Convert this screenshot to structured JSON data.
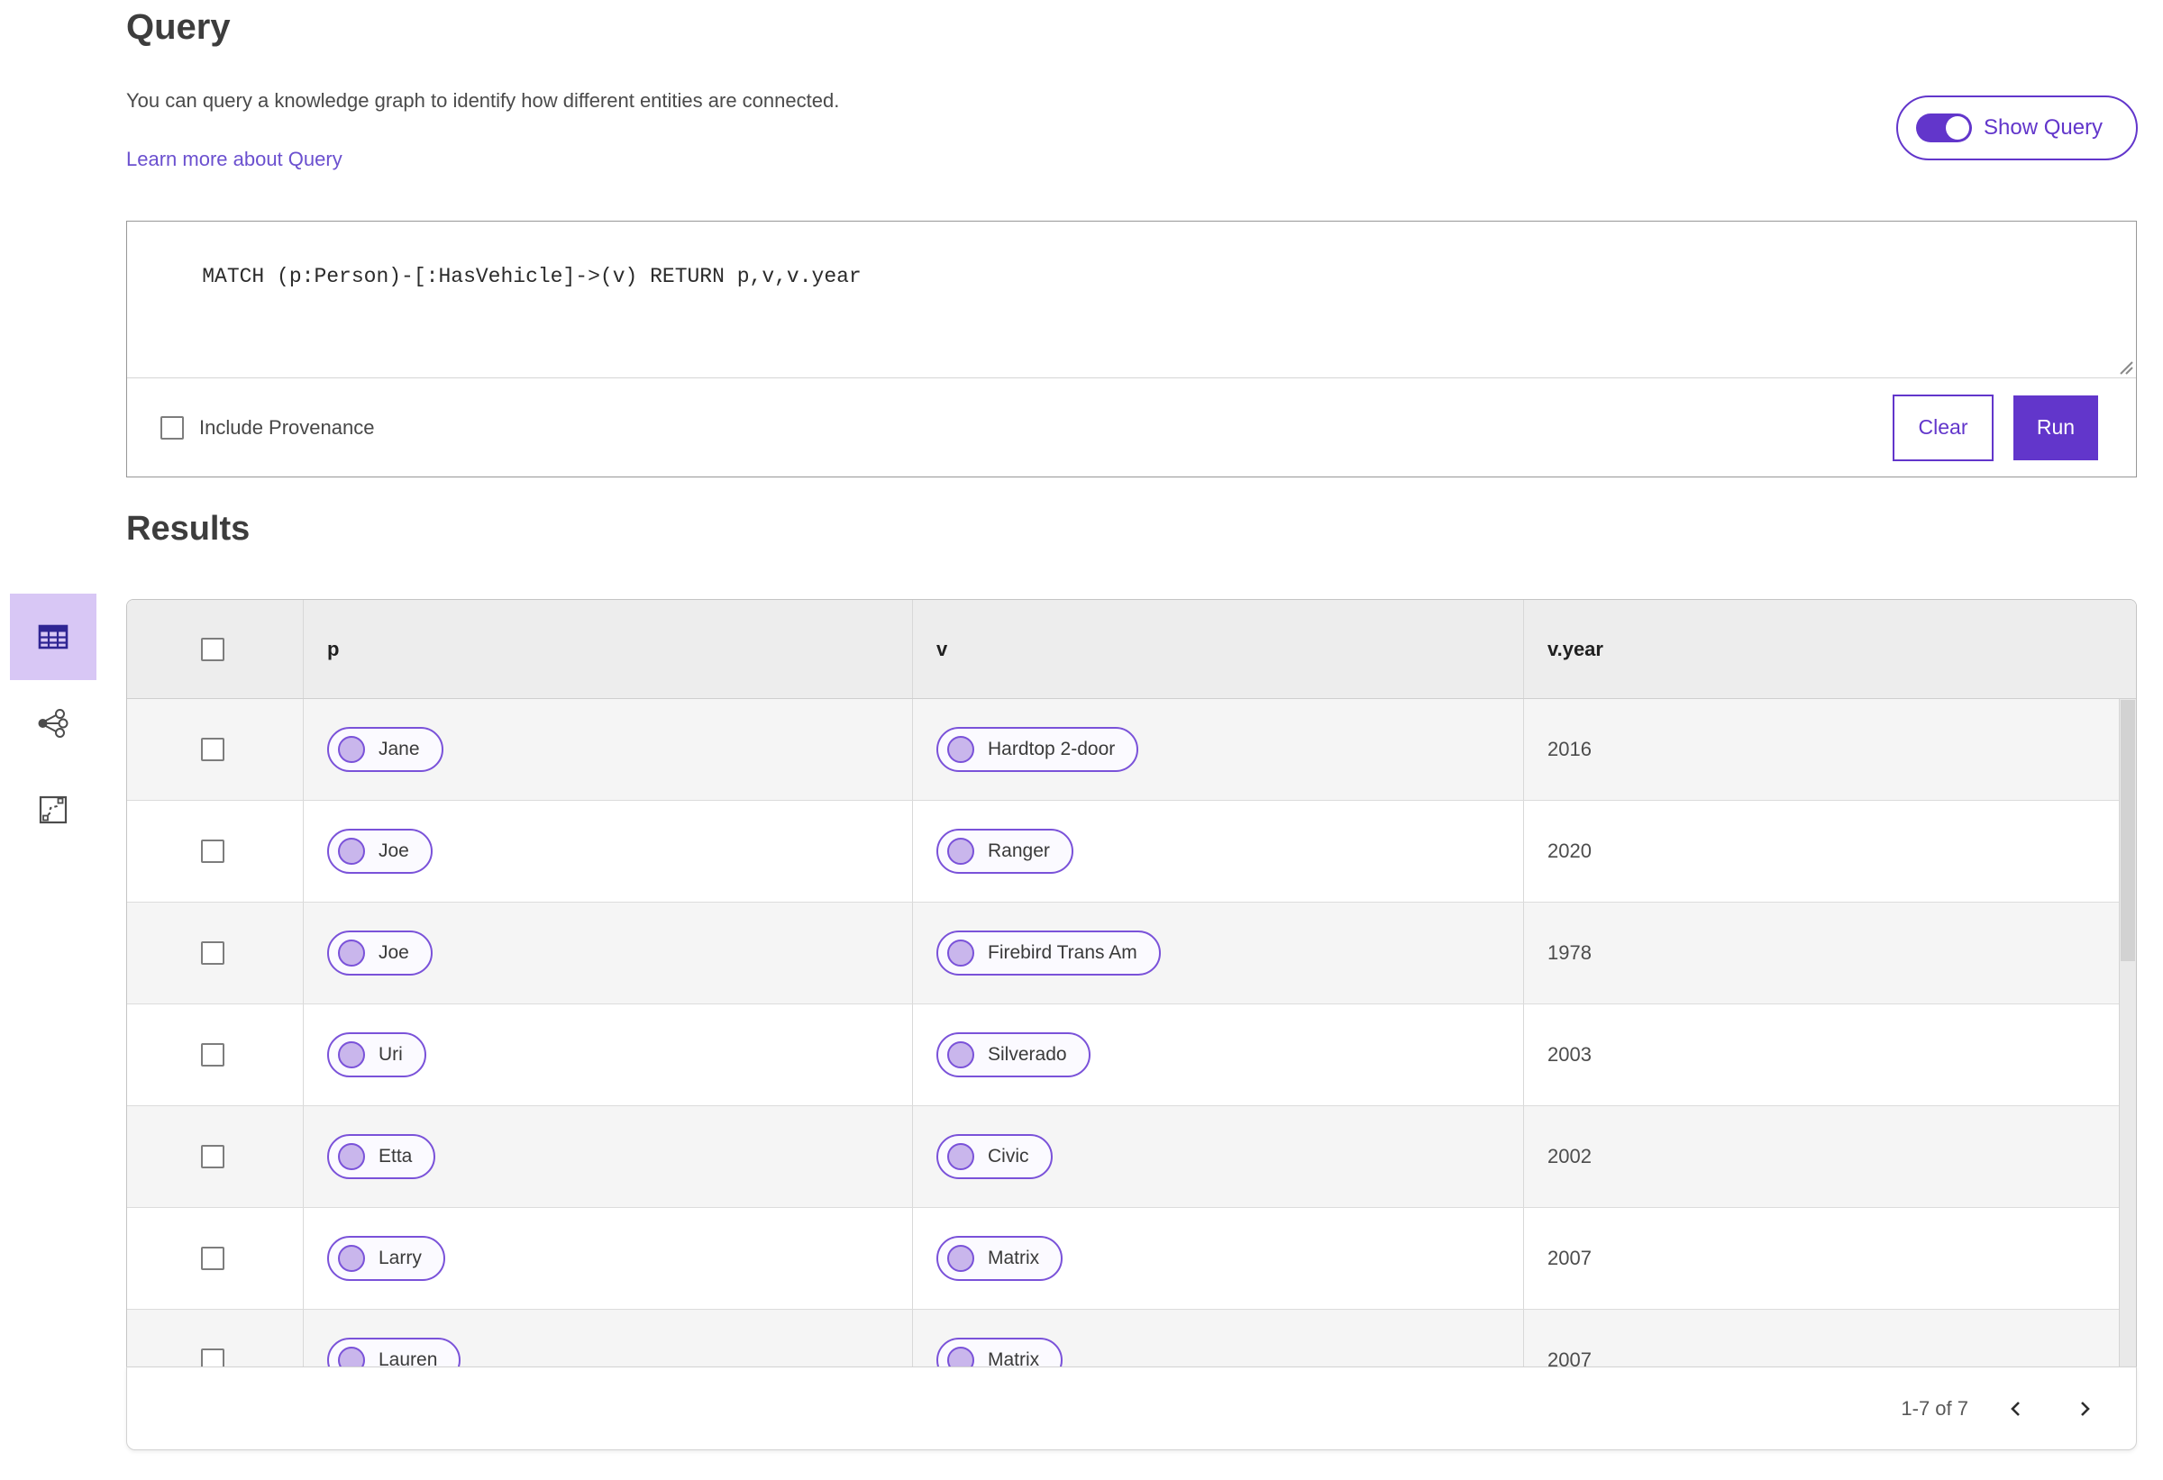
{
  "header": {
    "title": "Query",
    "description": "You can query a knowledge graph to identify how different entities are connected.",
    "link_label": "Learn more about Query",
    "toggle_label": "Show Query",
    "toggle_state": "on"
  },
  "query_box": {
    "query_text": "MATCH (p:Person)-[:HasVehicle]->(v) RETURN p,v,v.year",
    "include_provenance_label": "Include Provenance",
    "include_provenance_checked": false,
    "clear_label": "Clear",
    "run_label": "Run"
  },
  "sidebar": {
    "items": [
      {
        "name": "table-view",
        "icon": "table-icon",
        "selected": true
      },
      {
        "name": "graph-view",
        "icon": "graph-icon",
        "selected": false
      },
      {
        "name": "map-view",
        "icon": "map-icon",
        "selected": false
      }
    ]
  },
  "results": {
    "title": "Results",
    "columns": [
      "p",
      "v",
      "v.year"
    ],
    "rows": [
      {
        "p": "Jane",
        "v": "Hardtop 2-door",
        "year": "2016"
      },
      {
        "p": "Joe",
        "v": "Ranger",
        "year": "2020"
      },
      {
        "p": "Joe",
        "v": "Firebird Trans Am",
        "year": "1978"
      },
      {
        "p": "Uri",
        "v": "Silverado",
        "year": "2003"
      },
      {
        "p": "Etta",
        "v": "Civic",
        "year": "2002"
      },
      {
        "p": "Larry",
        "v": "Matrix",
        "year": "2007"
      },
      {
        "p": "Lauren",
        "v": "Matrix",
        "year": "2007"
      }
    ],
    "pagination": {
      "range_label": "1-7 of 7"
    }
  },
  "colors": {
    "accent": "#6236cb",
    "accent_light_bg": "#d8c7f5",
    "pill_border": "#7a52d9",
    "pill_bg": "#fbfaff",
    "pill_circle": "#c9b6ec",
    "table_header_bg": "#ededed",
    "row_alt_bg": "#f5f5f5",
    "link": "#6b50cf"
  }
}
